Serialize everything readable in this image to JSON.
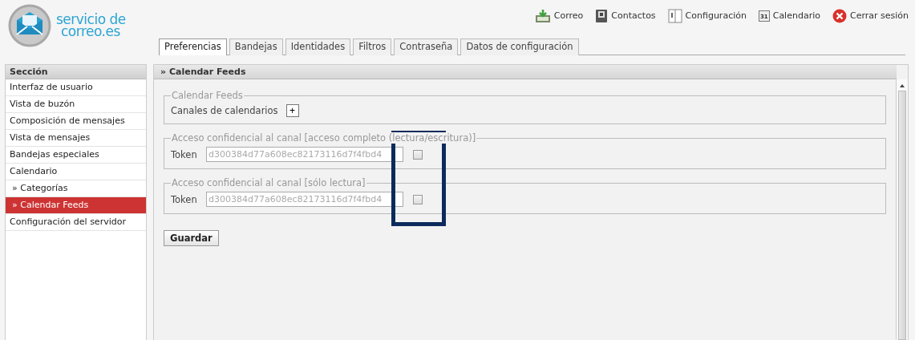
{
  "logo": {
    "line1": "servicio de",
    "line2": "correo.es"
  },
  "topnav": [
    {
      "kind": "mail",
      "label": "Correo"
    },
    {
      "kind": "contacts",
      "label": "Contactos"
    },
    {
      "kind": "settings",
      "label": "Configuración"
    },
    {
      "kind": "calendar",
      "label": "Calendario",
      "icon_text": "31"
    },
    {
      "kind": "logout",
      "label": "Cerrar sesión"
    }
  ],
  "tabs": [
    {
      "label": "Preferencias",
      "selected": true
    },
    {
      "label": "Bandejas",
      "selected": false
    },
    {
      "label": "Identidades",
      "selected": false
    },
    {
      "label": "Filtros",
      "selected": false
    },
    {
      "label": "Contraseña",
      "selected": false
    },
    {
      "label": "Datos de configuración",
      "selected": false
    }
  ],
  "sidebar": {
    "header": "Sección",
    "items": [
      {
        "label": "Interfaz de usuario",
        "selected": false
      },
      {
        "label": "Vista de buzón",
        "selected": false
      },
      {
        "label": "Composición de mensajes",
        "selected": false
      },
      {
        "label": "Vista de mensajes",
        "selected": false
      },
      {
        "label": "Bandejas especiales",
        "selected": false
      },
      {
        "label": "Calendario",
        "selected": false,
        "children": [
          {
            "label": "» Categorías",
            "selected": false
          },
          {
            "label": "» Calendar Feeds",
            "selected": true
          }
        ]
      },
      {
        "label": "Configuración del servidor",
        "selected": false
      }
    ]
  },
  "panel": {
    "title": "» Calendar Feeds",
    "feeds": {
      "legend": "Calendar Feeds",
      "label": "Canales de calendarios",
      "add_button": "+"
    },
    "tokens": [
      {
        "legend": "Acceso confidencial al canal [acceso completo (lectura/escritura)]",
        "label": "Token",
        "value": "d300384d77a608ec82173116d7f4fbd4",
        "checked": false
      },
      {
        "legend": "Acceso confidencial al canal [sólo lectura]",
        "label": "Token",
        "value": "d300384d77a608ec82173116d7f4fbd4",
        "checked": false
      }
    ],
    "save_button": "Guardar"
  }
}
